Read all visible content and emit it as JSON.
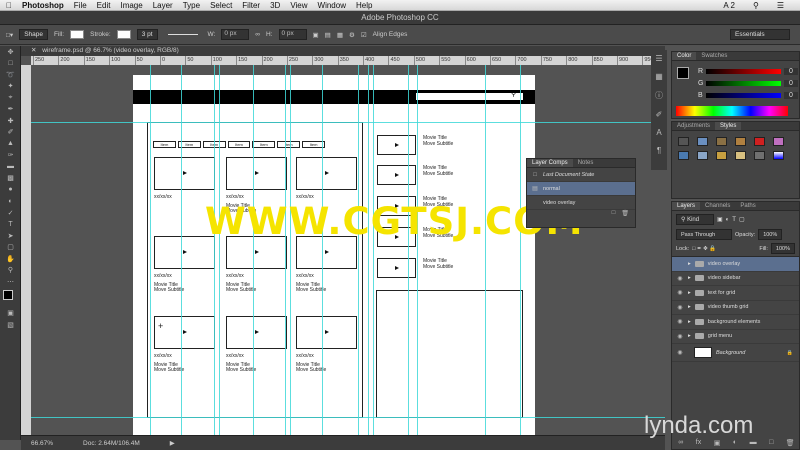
{
  "menubar": {
    "app": "Photoshop",
    "items": [
      "File",
      "Edit",
      "Image",
      "Layer",
      "Type",
      "Select",
      "Filter",
      "3D",
      "View",
      "Window",
      "Help"
    ],
    "right_badge": "A 2"
  },
  "window_title": "Adobe Photoshop CC",
  "options_bar": {
    "shape_mode": "Shape",
    "fill_label": "Fill:",
    "stroke_label": "Stroke:",
    "stroke_width": "3 pt",
    "w_label": "W:",
    "w_value": "0 px",
    "h_label": "H:",
    "h_value": "0 px",
    "align_edges": "Align Edges",
    "workspace": "Essentials"
  },
  "document_tab": "wireframe.psd @ 66.7% (video overlay, RGB/8)",
  "ruler_ticks": [
    "250",
    "200",
    "150",
    "100",
    "50",
    "0",
    "50",
    "100",
    "150",
    "200",
    "250",
    "300",
    "350",
    "400",
    "450",
    "500",
    "550",
    "600",
    "650",
    "700",
    "750",
    "800",
    "850",
    "900",
    "950"
  ],
  "status": {
    "zoom": "66.67%",
    "doc": "Doc: 2.64M/106.4M"
  },
  "wireframe": {
    "nav_items": [
      "Item",
      "Item",
      "Item",
      "Item",
      "Item",
      "Item",
      "Item"
    ],
    "date_label": "xx/xx/xx",
    "movie_title": "Movie Title",
    "movie_subtitle": "Move Subtitle"
  },
  "layer_comps": {
    "tabs": [
      "Layer Comps",
      "Notes"
    ],
    "rows": [
      "Last Document State",
      "normal",
      "video overlay"
    ]
  },
  "color_panel": {
    "tabs": [
      "Color",
      "Swatches"
    ],
    "values": [
      "0",
      "0",
      "0"
    ],
    "labels": [
      "R",
      "G",
      "B"
    ]
  },
  "adjustments_panel": {
    "tabs": [
      "Adjustments",
      "Styles"
    ]
  },
  "layers_panel": {
    "tabs": [
      "Layers",
      "Channels",
      "Paths"
    ],
    "kind": "Kind",
    "blend": "Pass Through",
    "opacity_label": "Opacity:",
    "opacity": "100%",
    "lock_label": "Lock:",
    "fill_label": "Fill:",
    "fill": "100%",
    "layers": [
      {
        "name": "video overlay",
        "selected": true
      },
      {
        "name": "video sidebar",
        "selected": false
      },
      {
        "name": "text for grid",
        "selected": false
      },
      {
        "name": "video thumb grid",
        "selected": false
      },
      {
        "name": "background elements",
        "selected": false
      },
      {
        "name": "grid menu",
        "selected": false
      },
      {
        "name": "Background",
        "selected": false
      }
    ]
  },
  "watermark": "WWW.CGTSJ.COM",
  "brand": "lynda.com",
  "colors": {
    "guide": "#3fd8d8",
    "watermark": "#f5e400",
    "selected_layer": "#5b6f8f"
  }
}
